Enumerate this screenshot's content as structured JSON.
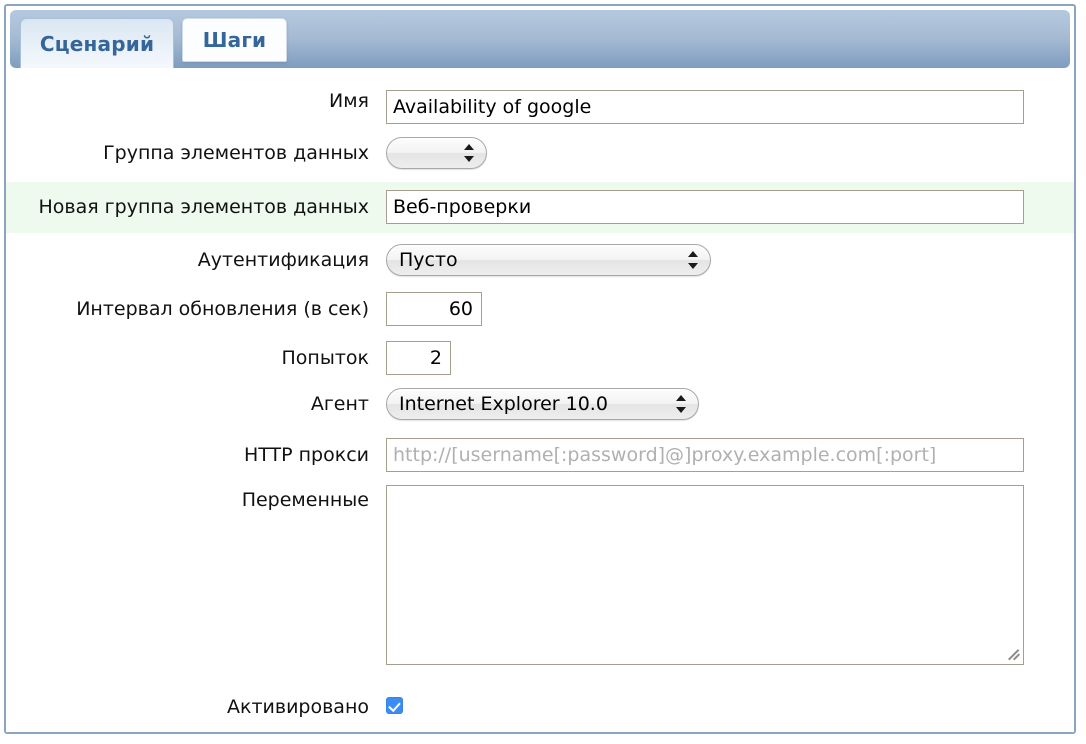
{
  "tabs": [
    {
      "label": "Сценарий",
      "active": true
    },
    {
      "label": "Шаги",
      "active": false
    }
  ],
  "form": {
    "name": {
      "label": "Имя",
      "value": "Availability of google"
    },
    "item_group": {
      "label": "Группа элементов данных",
      "value": ""
    },
    "new_item_group": {
      "label": "Новая группа элементов данных",
      "value": "Веб-проверки",
      "highlight_color": "#eefaee"
    },
    "authentication": {
      "label": "Аутентификация",
      "value": "Пусто"
    },
    "update_interval": {
      "label": "Интервал обновления (в сек)",
      "value": "60"
    },
    "attempts": {
      "label": "Попыток",
      "value": "2"
    },
    "agent": {
      "label": "Агент",
      "value": "Internet Explorer 10.0"
    },
    "http_proxy": {
      "label": "HTTP прокси",
      "value": "",
      "placeholder": "http://[username[:password]@]proxy.example.com[:port]"
    },
    "variables": {
      "label": "Переменные",
      "value": ""
    },
    "enabled": {
      "label": "Активировано",
      "checked": true,
      "accent_color": "#3b8cf5"
    }
  }
}
